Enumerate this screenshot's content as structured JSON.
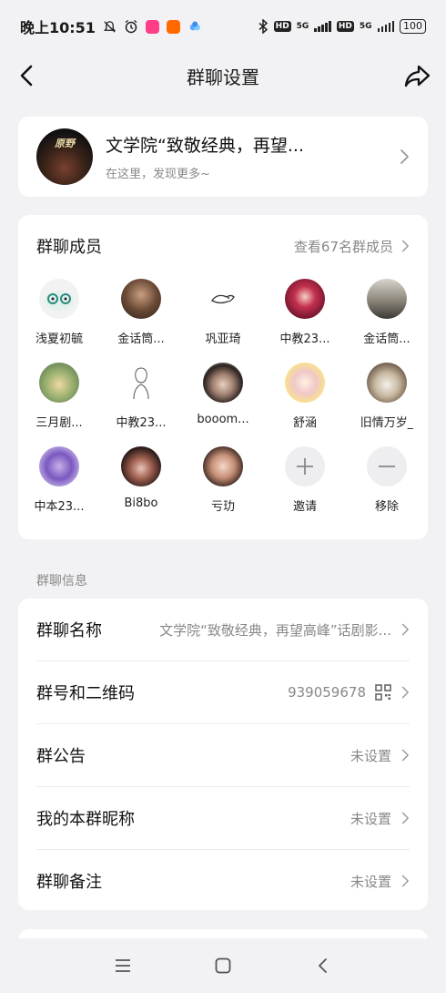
{
  "status_bar": {
    "time": "晚上10:51",
    "network": "5G",
    "hd": "HD",
    "battery": "100"
  },
  "nav": {
    "title": "群聊设置"
  },
  "group": {
    "avatar_text": "原野",
    "name": "文学院“致敬经典，再望...",
    "subtitle": "在这里，发现更多~"
  },
  "members": {
    "title": "群聊成员",
    "view_all": "查看67名群成员",
    "list": [
      {
        "name": "浅夏初毓"
      },
      {
        "name": "金话筒..."
      },
      {
        "name": "巩亚琦"
      },
      {
        "name": "中教23..."
      },
      {
        "name": "金话筒..."
      },
      {
        "name": "三月剧..."
      },
      {
        "name": "中教23..."
      },
      {
        "name": "booom..."
      },
      {
        "name": "舒涵"
      },
      {
        "name": "旧情万岁_"
      },
      {
        "name": "中本23..."
      },
      {
        "name": "Bi8bo"
      },
      {
        "name": "亏玏"
      }
    ],
    "invite_label": "邀请",
    "remove_label": "移除"
  },
  "info_section": {
    "label": "群聊信息",
    "rows": [
      {
        "key": "群聊名称",
        "value": "文学院“致敬经典，再望高峰”话剧影..."
      },
      {
        "key": "群号和二维码",
        "value": "939059678"
      },
      {
        "key": "群公告",
        "value": "未设置"
      },
      {
        "key": "我的本群昵称",
        "value": "未设置"
      },
      {
        "key": "群聊备注",
        "value": "未设置"
      }
    ]
  },
  "colors": {
    "background": "#f2f2f4",
    "card": "#ffffff",
    "secondary_text": "#888888"
  }
}
